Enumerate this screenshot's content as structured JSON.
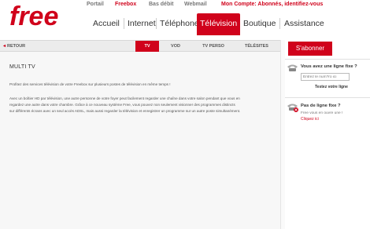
{
  "brand": {
    "logo_text": "free",
    "accent": "#d0021b"
  },
  "topnav": {
    "portail": "Portail",
    "freebox": "Freebox",
    "bas_debit": "Bas débit",
    "webmail": "Webmail",
    "account": "Mon Compte: Abonnés, identifiez-vous"
  },
  "mainnav": {
    "accueil": "Accueil",
    "internet": "Internet",
    "telephone": "Téléphone",
    "television": "Télévision",
    "boutique": "Boutique",
    "assistance": "Assistance"
  },
  "subnav": {
    "back": "RETOUR",
    "tabs": [
      "TV",
      "VOD",
      "TV PERSO",
      "TÉLÉSITES"
    ]
  },
  "content": {
    "title": "MULTI TV",
    "paragraph1": "Profitez des services télévision de votre Freebox sur plusieurs postes de télévision en même temps !",
    "paragraph2_line1": "Avec un boîtier HD par télévision, une autre personne de votre foyer peut facilement regarder une chaîne dans votre salon pendant que vous en",
    "paragraph2_line2": "regardez une autre dans votre chambre. Grâce à ce nouveau système Free, vous pouvez non seulement visionner des programmes distincts",
    "paragraph2_line3": "sur différents écrans avec un seul accès ADSL, mais aussi regarder la télévision et enregistrer un programme sur un autre poste simultanément."
  },
  "sidebar": {
    "subscribe": "S'abonner",
    "line_check": {
      "title": "Vous avez une ligne fixe ?",
      "placeholder": "Entrez le num?ro ici",
      "button": "Testez votre ligne"
    },
    "no_line": {
      "title": "Pas de ligne fixe ?",
      "desc": "Free vous en ouvre une !",
      "link": "Cliquez ici"
    }
  }
}
